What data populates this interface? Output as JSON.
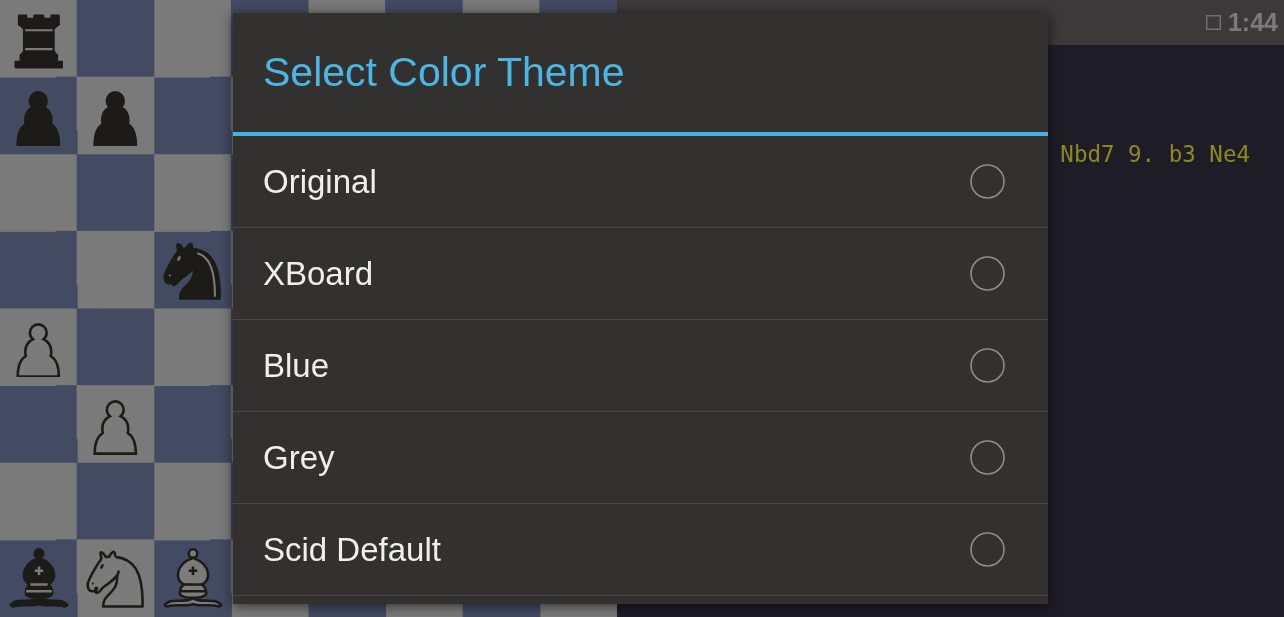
{
  "board": {
    "rows": [
      {
        "squares": [
          {
            "kind": "rook",
            "dark": true
          },
          {
            "kind": "none"
          },
          {
            "kind": "none"
          }
        ]
      },
      {
        "squares": [
          {
            "kind": "pawn",
            "dark": true
          },
          {
            "kind": "pawn",
            "dark": true
          },
          {
            "kind": "none"
          }
        ]
      },
      {
        "squares": [
          {
            "kind": "none"
          },
          {
            "kind": "none"
          },
          {
            "kind": "none"
          }
        ]
      },
      {
        "squares": [
          {
            "kind": "none"
          },
          {
            "kind": "none"
          },
          {
            "kind": "knight",
            "dark": true
          }
        ]
      },
      {
        "squares": [
          {
            "kind": "pawn",
            "dark": false
          },
          {
            "kind": "none"
          },
          {
            "kind": "none"
          }
        ]
      },
      {
        "squares": [
          {
            "kind": "none"
          },
          {
            "kind": "pawn",
            "dark": false
          },
          {
            "kind": "none"
          }
        ]
      },
      {
        "squares": [
          {
            "kind": "none"
          },
          {
            "kind": "none"
          },
          {
            "kind": "none"
          }
        ]
      },
      {
        "squares": [
          {
            "kind": "bishop",
            "dark": true
          },
          {
            "kind": "knight",
            "dark": false
          },
          {
            "kind": "bishop",
            "dark": false
          }
        ]
      }
    ]
  },
  "status_bar": {
    "time": "1:44"
  },
  "move_list": {
    "text": "Nbd7 9. b3 Ne4"
  },
  "dialog": {
    "title": "Select Color Theme",
    "options": [
      {
        "label": "Original",
        "selected": false
      },
      {
        "label": "XBoard",
        "selected": false
      },
      {
        "label": "Blue",
        "selected": false
      },
      {
        "label": "Grey",
        "selected": false
      },
      {
        "label": "Scid Default",
        "selected": false
      }
    ]
  }
}
